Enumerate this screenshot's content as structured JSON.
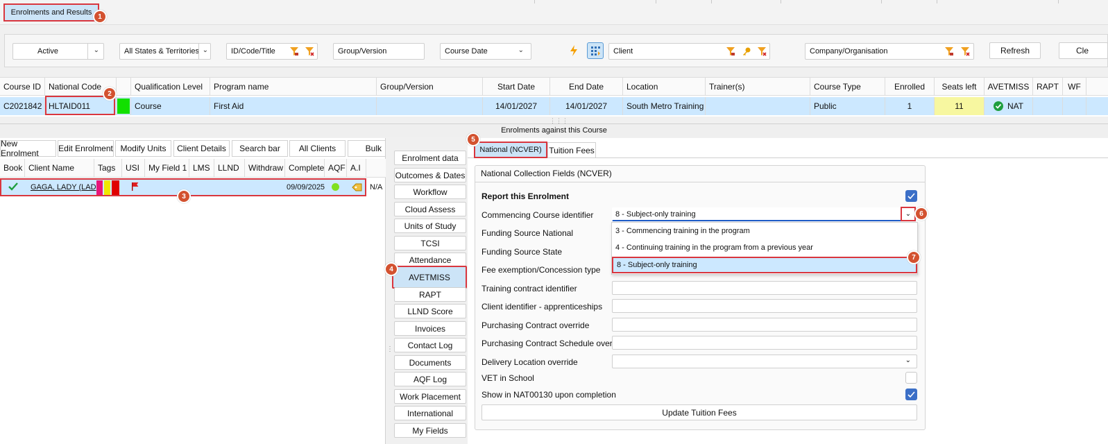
{
  "top_tab": {
    "label": "Enrolments and Results"
  },
  "badges": [
    "1",
    "2",
    "3",
    "4",
    "5",
    "6",
    "7"
  ],
  "filters": {
    "status": "Active",
    "states": "All States & Territories",
    "id_code_title": "ID/Code/Title",
    "group_version": "Group/Version",
    "date_type": "Course Date",
    "client": "Client",
    "company": "Company/Organisation",
    "refresh": "Refresh",
    "clear": "Cle"
  },
  "course_grid": {
    "headers": [
      "Course ID",
      "National Code",
      "",
      "Qualification Level",
      "Program name",
      "Group/Version",
      "Start Date",
      "End Date",
      "Location",
      "Trainer(s)",
      "Course Type",
      "Enrolled",
      "Seats left",
      "AVETMISS",
      "RAPT",
      "WF"
    ],
    "row": {
      "course_id": "C2021842",
      "national_code": "HLTAID011",
      "qualification_level": "Course",
      "program_name": "First Aid",
      "group_version": "",
      "start_date": "14/01/2027",
      "end_date": "14/01/2027",
      "location": "South Metro Training C",
      "trainers": "",
      "course_type": "Public",
      "enrolled": "1",
      "seats_left": "11",
      "avetmiss": "NAT"
    }
  },
  "section_header": "Enrolments against this Course",
  "enrol_buttons": [
    "New Enrolment",
    "Edit Enrolment",
    "Modify Units",
    "Client Details",
    "Search bar",
    "All Clients",
    "Bulk"
  ],
  "enrol_grid": {
    "headers": [
      "Book",
      "Client Name",
      "Tags",
      "USI",
      "My Field 1",
      "LMS",
      "LLND",
      "Withdraw",
      "Complete",
      "AQF",
      "A.I"
    ],
    "row": {
      "client_name": "GAGA, LADY (LAD",
      "complete": "09/09/2025",
      "extra": "N/A"
    }
  },
  "side_tabs": [
    "Enrolment data",
    "Outcomes & Dates",
    "Workflow",
    "Cloud Assess",
    "Units of Study",
    "TCSI",
    "Attendance",
    "AVETMISS",
    "RAPT",
    "LLND Score",
    "Invoices",
    "Contact Log",
    "Documents",
    "AQF Log",
    "Work Placement",
    "International",
    "My Fields"
  ],
  "detail_tabs": [
    "National (NCVER)",
    "Tuition Fees"
  ],
  "ncver": {
    "group_title": "National Collection Fields (NCVER)",
    "report_label": "Report this Enrolment",
    "fields": {
      "commencing": "Commencing Course identifier",
      "funding_national": "Funding Source National",
      "funding_state": "Funding Source State",
      "fee_exemption": "Fee exemption/Concession type",
      "training_contract": "Training contract identifier",
      "client_identifier": "Client identifier - apprenticeships",
      "purchasing_override": "Purchasing Contract override",
      "purchasing_schedule": "Purchasing Contract Schedule override",
      "delivery_location": "Delivery Location override",
      "vet_school": "VET in School",
      "show_nat": "Show in NAT00130 upon completion"
    },
    "commencing_value": "8 - Subject-only training",
    "dropdown_options": [
      "3 - Commencing training in the program",
      "4 -  Continuing training in the program from a previous year",
      "8 - Subject-only training"
    ],
    "update_button": "Update Tuition Fees"
  }
}
